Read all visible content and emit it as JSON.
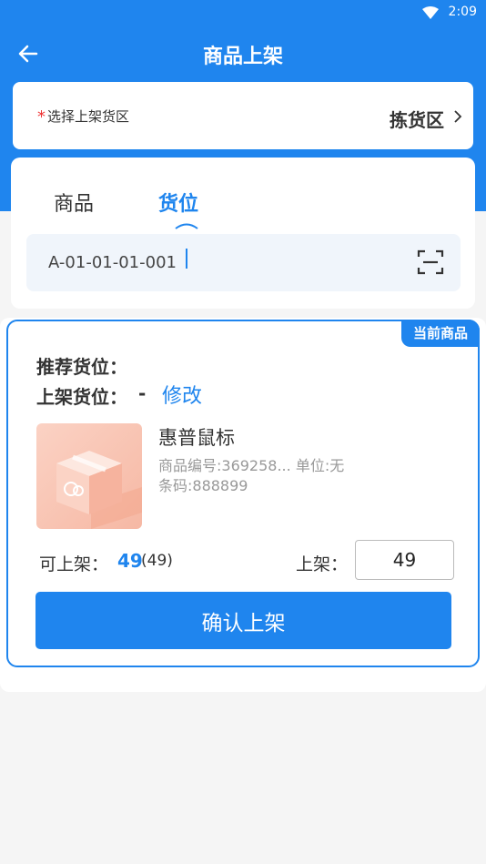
{
  "status_bar": {
    "time": "2:09",
    "wifi_icon": "wifi-icon"
  },
  "app_bar": {
    "title": "商品上架",
    "back_icon": "arrow-left-icon"
  },
  "zone": {
    "required_mark": "*",
    "label": "选择上架货区",
    "value": "拣货区",
    "chevron_icon": "chevron-right-icon"
  },
  "tabs": [
    {
      "label": "商品",
      "active": false
    },
    {
      "label": "货位",
      "active": true
    }
  ],
  "location_input": {
    "value": "A-01-01-01-001",
    "scan_icon": "scan-icon"
  },
  "goods_card": {
    "badge": "当前商品",
    "recommend_label": "推荐货位：",
    "put_label": "上架货位：",
    "put_value": "-",
    "modify_link": "修改",
    "product": {
      "image_icon": "package-box-icon",
      "name": "惠普鼠标",
      "meta_line1": "商品编号:369258...  单位:无",
      "meta_line2": "条码:888899"
    },
    "available_label": "可上架：",
    "available_value": "49",
    "available_total": "(49)",
    "quantity_label": "上架：",
    "quantity_value": "49",
    "confirm_button": "确认上架"
  },
  "colors": {
    "primary": "#1f85ee",
    "required": "#ee3333",
    "background": "#f5f5f5"
  }
}
